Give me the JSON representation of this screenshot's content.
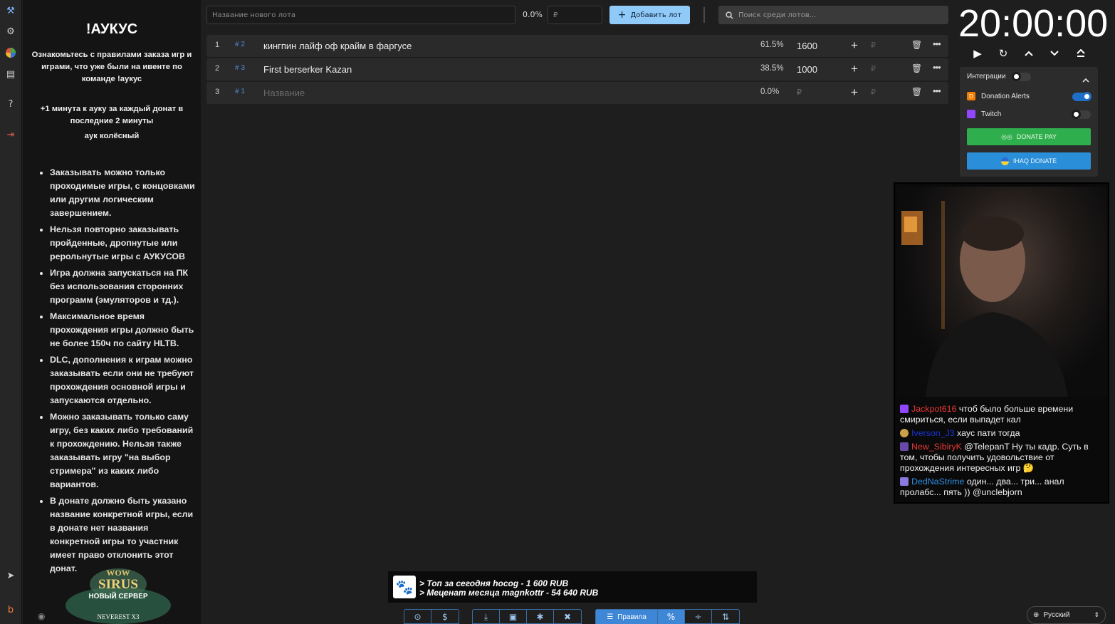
{
  "rules": {
    "title": "!АУКУС",
    "lead1": "Ознакомьтесь с правилами заказа игр и играми, что уже были на ивенте по команде !аукус",
    "lead2": "+1 минута к ауку за каждый донат в последние 2 минуты",
    "lead3": "аук колёсный",
    "items": [
      "Заказывать можно только проходимые игры, с концовками или другим логическим завершением.",
      "Нельзя повторно заказывать пройденные, дропнутые или рерольнутые игры с АУКУСОВ",
      "Игра должна запускаться на ПК без использования сторонних программ (эмуляторов и тд.).",
      "Максимальное время прохождения игры должно быть не более 150ч по сайту HLTB.",
      "DLC, дополнения к играм можно заказывать если они не требуют прохождения основной игры и запускаются отдельно.",
      "Можно заказывать только саму игру, без каких либо требований к прохождению. Нельзя также заказывать игру \"на выбор стримера\" из каких либо вариантов.",
      "В донате должно быть указано название конкретной игры, если в донате нет названия конкретной игры то участник имеет право отклонить этот донат."
    ],
    "logo": {
      "line1": "WOW",
      "line2": "SIRUS",
      "line3": "НОВЫЙ СЕРВЕР",
      "line4": "NEVEREST X3"
    }
  },
  "topbar": {
    "lot_name_placeholder": "Название нового лота",
    "lot_percent": "0.0%",
    "amount_placeholder": "₽",
    "add_label": "Добавить лот",
    "search_placeholder": "Поиск среди лотов..."
  },
  "lots": [
    {
      "index": "1",
      "fast_id": "# 2",
      "name": "кингпин лайф оф крайм в фаргусе",
      "percent": "61.5%",
      "amount": "1600",
      "currency": "₽"
    },
    {
      "index": "2",
      "fast_id": "# 3",
      "name": "First berserker Kazan",
      "percent": "38.5%",
      "amount": "1000",
      "currency": "₽"
    },
    {
      "index": "3",
      "fast_id": "# 1",
      "name": "Название",
      "percent": "0.0%",
      "amount": "₽",
      "currency": "₽"
    }
  ],
  "timer": {
    "value": "20:00:00"
  },
  "integrations": {
    "header": "Интеграции",
    "donation_alerts": "Donation Alerts",
    "twitch": "Twitch",
    "donate_pay": "DONATE PAY",
    "ihaq": "IHAQ DONATE",
    "donation_alerts_on": true,
    "twitch_on": false
  },
  "chat": [
    {
      "user": "Jackpot616",
      "color": "#e53935",
      "text": "чтоб было больше времени смириться, если выпадет кал"
    },
    {
      "user": "Iverson_J3",
      "color": "#1a33d6",
      "text": "хаус пати тогда"
    },
    {
      "user": "New_SibiryK",
      "color": "#e53935",
      "text": "@TelepanT Ну ты кадр. Суть в том, чтобы получить удовольствие от прохождения интересных игр 🤔"
    },
    {
      "user": "DedNaStrime",
      "color": "#2f8fe0",
      "text": "один... два... три... анал пролабс... пять )) @unclebjorn"
    }
  ],
  "banner": {
    "line1": "> Топ за сегодня hocog - 1 600 RUB",
    "line2": "> Меценат месяца magnkottr - 54 640 RUB"
  },
  "toolbar": {
    "rules_label": "Правила",
    "percent_label": "%"
  },
  "language": {
    "current": "Русский"
  }
}
